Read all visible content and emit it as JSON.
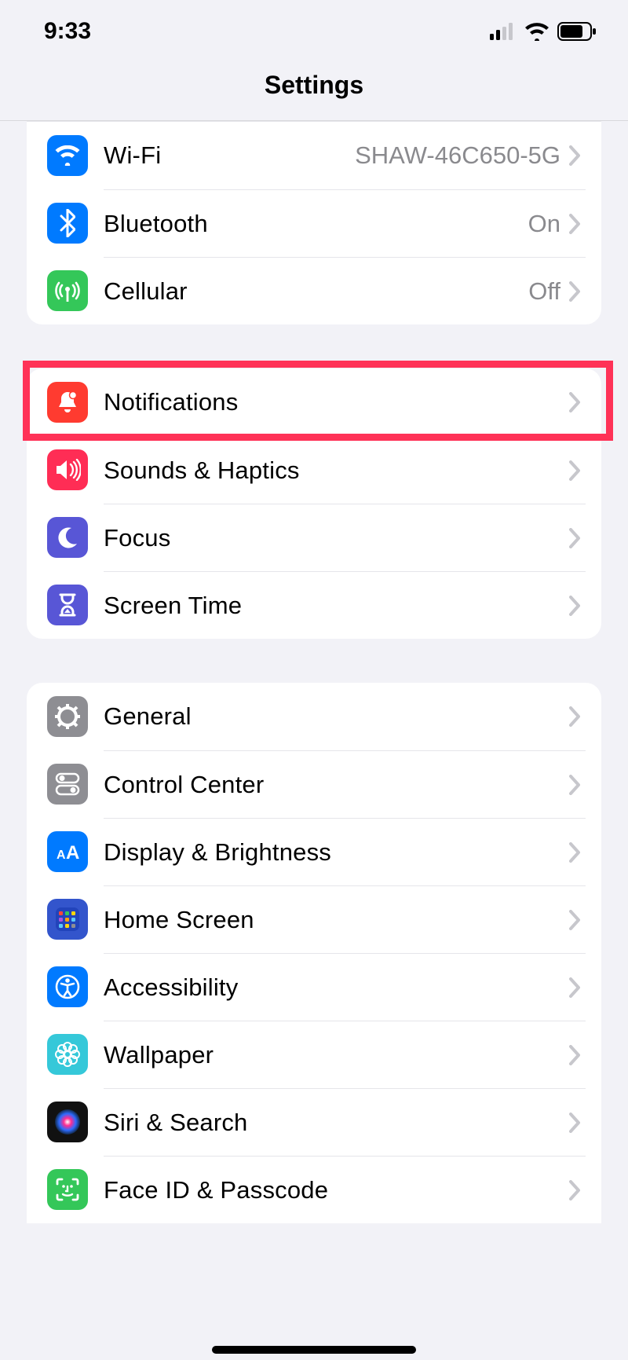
{
  "status": {
    "time": "9:33"
  },
  "header": {
    "title": "Settings"
  },
  "groups": [
    {
      "rows": [
        {
          "icon": "wifi",
          "bg": "#007aff",
          "label": "Wi-Fi",
          "value": "SHAW-46C650-5G"
        },
        {
          "icon": "bluetooth",
          "bg": "#007aff",
          "label": "Bluetooth",
          "value": "On"
        },
        {
          "icon": "cellular",
          "bg": "#34c759",
          "label": "Cellular",
          "value": "Off"
        }
      ]
    },
    {
      "rows": [
        {
          "icon": "bell",
          "bg": "#ff3b30",
          "label": "Notifications",
          "highlight": true
        },
        {
          "icon": "speaker",
          "bg": "#ff2d55",
          "label": "Sounds & Haptics"
        },
        {
          "icon": "moon",
          "bg": "#5856d6",
          "label": "Focus"
        },
        {
          "icon": "hourglass",
          "bg": "#5856d6",
          "label": "Screen Time"
        }
      ]
    },
    {
      "rows": [
        {
          "icon": "gear",
          "bg": "#8e8e93",
          "label": "General"
        },
        {
          "icon": "toggles",
          "bg": "#8e8e93",
          "label": "Control Center"
        },
        {
          "icon": "textsize",
          "bg": "#007aff",
          "label": "Display & Brightness"
        },
        {
          "icon": "grid",
          "bg": "#3355cc",
          "label": "Home Screen"
        },
        {
          "icon": "body",
          "bg": "#007aff",
          "label": "Accessibility"
        },
        {
          "icon": "flower",
          "bg": "#35c8d9",
          "label": "Wallpaper"
        },
        {
          "icon": "siri",
          "bg": "#000000",
          "label": "Siri & Search"
        },
        {
          "icon": "faceid",
          "bg": "#34c759",
          "label": "Face ID & Passcode"
        }
      ]
    }
  ]
}
